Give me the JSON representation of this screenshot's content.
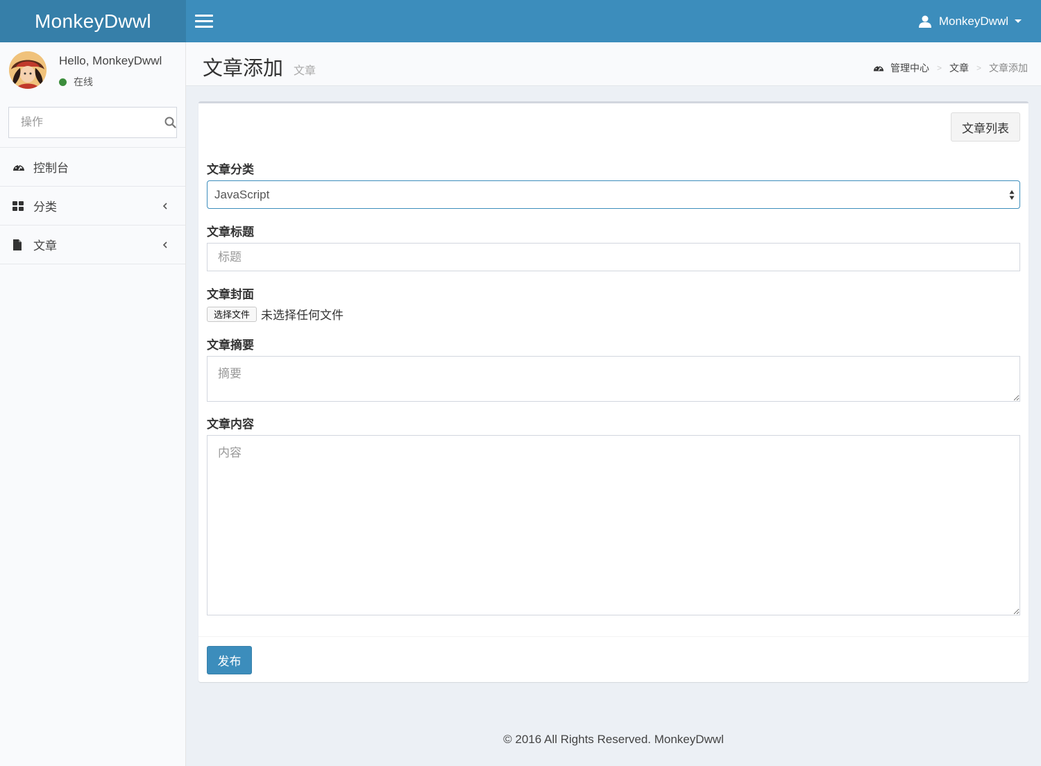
{
  "header": {
    "logo": "MonkeyDwwl",
    "user_name": "MonkeyDwwl"
  },
  "sidebar": {
    "greeting": "Hello, MonkeyDwwl",
    "status": "在线",
    "status_color": "#3c8d3c",
    "search_placeholder": "操作",
    "menu": [
      {
        "label": "控制台",
        "icon": "dashboard-icon"
      },
      {
        "label": "分类",
        "icon": "grid-icon",
        "expandable": true
      },
      {
        "label": "文章",
        "icon": "file-icon",
        "expandable": true
      }
    ]
  },
  "content_header": {
    "title": "文章添加",
    "subtitle": "文章",
    "breadcrumb": [
      "管理中心",
      "文章",
      "文章添加"
    ]
  },
  "form": {
    "list_button": "文章列表",
    "category_label": "文章分类",
    "category_value": "JavaScript",
    "title_label": "文章标题",
    "title_placeholder": "标题",
    "cover_label": "文章封面",
    "file_button": "选择文件",
    "file_status": "未选择任何文件",
    "summary_label": "文章摘要",
    "summary_placeholder": "摘要",
    "content_label": "文章内容",
    "content_placeholder": "内容",
    "submit": "发布"
  },
  "footer": {
    "text": "© 2016 All Rights Reserved. MonkeyDwwl"
  },
  "colors": {
    "primary": "#3c8dbc",
    "logo_bg": "#367fa9",
    "sidebar_bg": "#f9fafc",
    "page_bg": "#ecf0f5"
  }
}
